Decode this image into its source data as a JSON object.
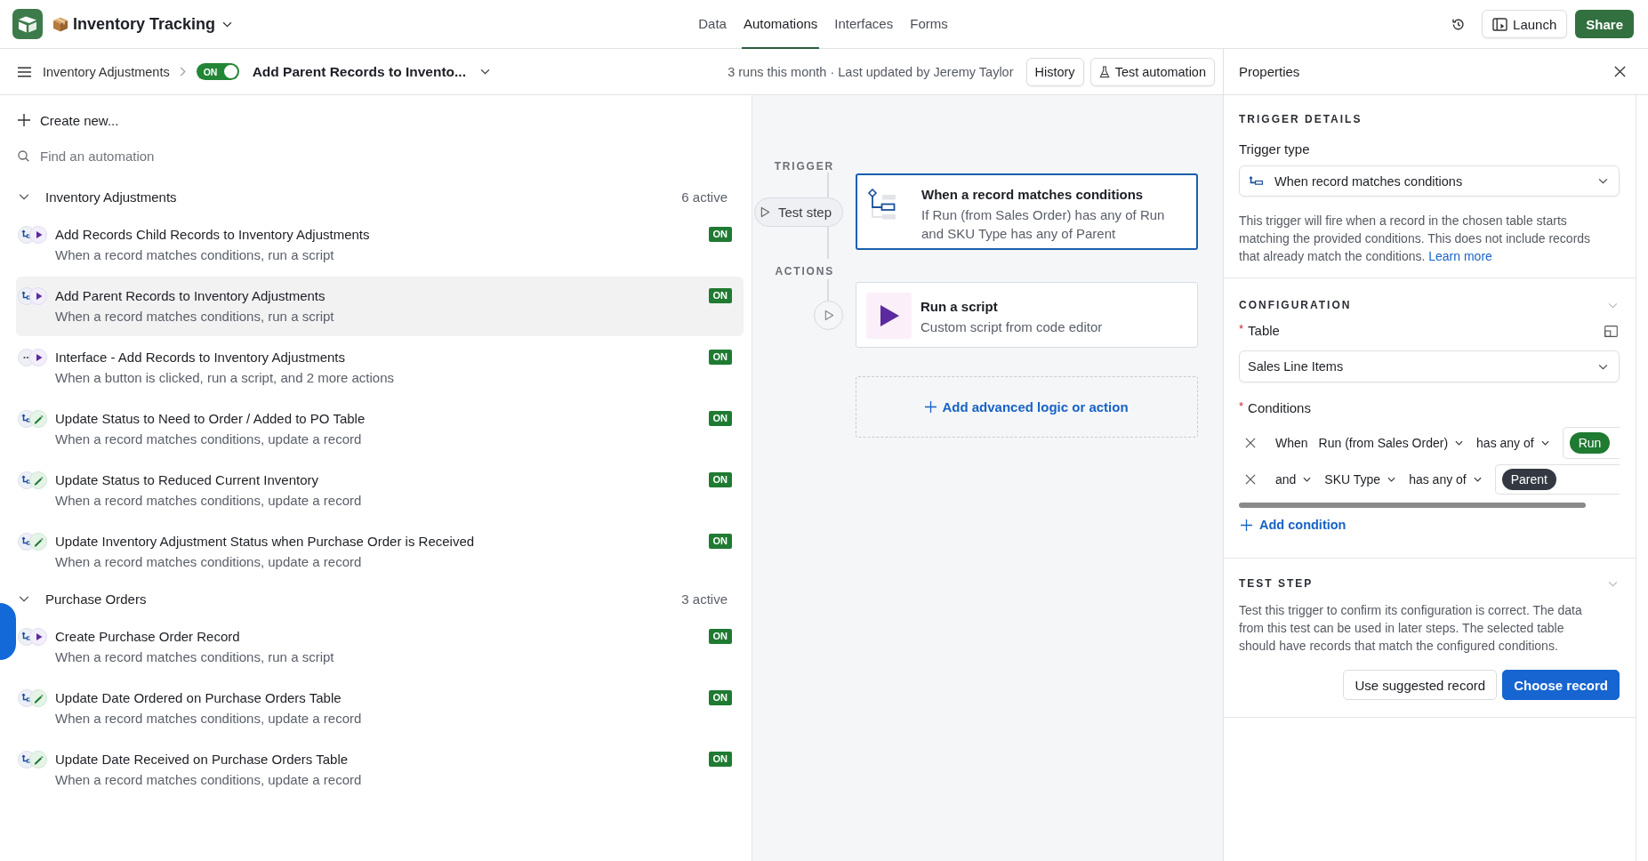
{
  "top_bar": {
    "base_name": "Inventory Tracking",
    "nav_tabs": [
      {
        "label": "Data",
        "selected": false
      },
      {
        "label": "Automations",
        "selected": true
      },
      {
        "label": "Interfaces",
        "selected": false
      },
      {
        "label": "Forms",
        "selected": false
      }
    ],
    "launch_button": "Launch",
    "share_button": "Share"
  },
  "automation_bar": {
    "breadcrumb": "Inventory Adjustments",
    "toggle": {
      "label": "ON",
      "on": true
    },
    "automation_name": "Add Parent Records to Invento...",
    "meta": "3 runs this month · Last updated by Jeremy Taylor",
    "history_button": "History",
    "test_button": "Test automation"
  },
  "sidebar": {
    "create_new": "Create new...",
    "search": {
      "placeholder": "Find an automation"
    },
    "groups": [
      {
        "name": "Inventory Adjustments",
        "count": "6 active",
        "expanded": true,
        "items": [
          {
            "title": "Add Records Child Records to Inventory Adjustments",
            "subtitle": "When a record matches conditions, run a script",
            "trigger": {
              "kind": "conditions"
            },
            "action": {
              "kind": "script"
            },
            "status": "ON",
            "on": true,
            "selected": false
          },
          {
            "title": "Add Parent Records to Inventory Adjustments",
            "subtitle": "When a record matches conditions, run a script",
            "trigger": {
              "kind": "conditions"
            },
            "action": {
              "kind": "script"
            },
            "status": "ON",
            "on": true,
            "selected": true
          },
          {
            "title": "Interface - Add Records to Inventory Adjustments",
            "subtitle": "When a button is clicked, run a script, and 2 more actions",
            "trigger": {
              "kind": "button"
            },
            "action": {
              "kind": "script"
            },
            "status": "ON",
            "on": true,
            "selected": false
          },
          {
            "title": "Update Status to Need to Order / Added to PO Table",
            "subtitle": "When a record matches conditions, update a record",
            "trigger": {
              "kind": "conditions"
            },
            "action": {
              "kind": "update"
            },
            "status": "ON",
            "on": true,
            "selected": false
          },
          {
            "title": "Update Status to Reduced Current Inventory",
            "subtitle": "When a record matches conditions, update a record",
            "trigger": {
              "kind": "conditions"
            },
            "action": {
              "kind": "update"
            },
            "status": "ON",
            "on": true,
            "selected": false
          },
          {
            "title": "Update Inventory Adjustment Status when Purchase Order is Received",
            "subtitle": "When a record matches conditions, update a record",
            "trigger": {
              "kind": "conditions"
            },
            "action": {
              "kind": "update"
            },
            "status": "ON",
            "on": true,
            "selected": false
          }
        ]
      },
      {
        "name": "Purchase Orders",
        "count": "3 active",
        "expanded": true,
        "items": [
          {
            "title": "Create Purchase Order Record",
            "subtitle": "When a record matches conditions, run a script",
            "trigger": {
              "kind": "conditions"
            },
            "action": {
              "kind": "script"
            },
            "status": "ON",
            "on": true,
            "selected": false
          },
          {
            "title": "Update Date Ordered on Purchase Orders Table",
            "subtitle": "When a record matches conditions, update a record",
            "trigger": {
              "kind": "conditions"
            },
            "action": {
              "kind": "update"
            },
            "status": "ON",
            "on": true,
            "selected": false
          },
          {
            "title": "Update Date Received on Purchase Orders Table",
            "subtitle": "When a record matches conditions, update a record",
            "trigger": {
              "kind": "conditions"
            },
            "action": {
              "kind": "update"
            },
            "status": "ON",
            "on": true,
            "selected": false
          }
        ]
      }
    ]
  },
  "canvas": {
    "trigger_label": "TRIGGER",
    "test_step_button": "Test step",
    "trigger_card": {
      "kind": "conditions",
      "title": "When a record matches conditions",
      "description": "If Run (from Sales Order) has any of Run and SKU Type has any of Parent",
      "selected": true
    },
    "actions_label": "ACTIONS",
    "actions": [
      {
        "kind": "script",
        "title": "Run a script",
        "description": "Custom script from code editor",
        "selected": false
      }
    ],
    "add_button": "Add advanced logic or action"
  },
  "properties": {
    "title": "Properties",
    "trigger_details": {
      "heading": "TRIGGER DETAILS",
      "trigger_type_label": "Trigger type",
      "trigger_type": {
        "kind": "conditions",
        "label": "When record matches conditions"
      },
      "description": "This trigger will fire when a record in the chosen table starts matching the provided conditions. This does not include records that already match the conditions.",
      "link": "Learn more"
    },
    "configuration": {
      "heading": "CONFIGURATION",
      "expanded": true,
      "table_field": {
        "label": "Table",
        "required_mark": "*",
        "value": "Sales Line Items"
      },
      "conditions_field": {
        "label": "Conditions",
        "required_mark": "*"
      },
      "conditions": [
        {
          "conjunction": {
            "label": "When",
            "dropdown": false
          },
          "field": "Run (from Sales Order)",
          "operator": "has any of",
          "values": [
            {
              "label": "Run",
              "color": "#1f7a32"
            }
          ]
        },
        {
          "conjunction": {
            "label": "and",
            "dropdown": true
          },
          "field": "SKU Type",
          "operator": "has any of",
          "values": [
            {
              "label": "Parent",
              "color": "#333842"
            }
          ]
        }
      ],
      "add_condition": "Add condition"
    },
    "test_step": {
      "heading": "TEST STEP",
      "expanded": true,
      "description": "Test this trigger to confirm its configuration is correct. The data from this test can be used in later steps. The selected table should have records that match the configured conditions.",
      "buttons": [
        {
          "label": "Use suggested record",
          "kind": "secondary"
        },
        {
          "label": "Choose record",
          "kind": "primary"
        }
      ]
    }
  }
}
